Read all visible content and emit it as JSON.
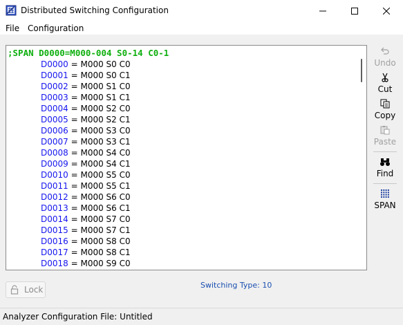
{
  "window": {
    "title": "Distributed Switching Configuration",
    "minimize_icon": "minimize-icon",
    "maximize_icon": "maximize-icon",
    "close_icon": "close-icon"
  },
  "menu": {
    "items": [
      {
        "label": "File"
      },
      {
        "label": "Configuration"
      }
    ]
  },
  "editor": {
    "header_line": ";SPAN D0000=M000-004 S0-14 C0-1",
    "header_color": "#0eaf0e",
    "device_color": "#1515ee",
    "rows": [
      {
        "device": "D0000",
        "mapping": " = M000 S0 C0"
      },
      {
        "device": "D0001",
        "mapping": " = M000 S0 C1"
      },
      {
        "device": "D0002",
        "mapping": " = M000 S1 C0"
      },
      {
        "device": "D0003",
        "mapping": " = M000 S1 C1"
      },
      {
        "device": "D0004",
        "mapping": " = M000 S2 C0"
      },
      {
        "device": "D0005",
        "mapping": " = M000 S2 C1"
      },
      {
        "device": "D0006",
        "mapping": " = M000 S3 C0"
      },
      {
        "device": "D0007",
        "mapping": " = M000 S3 C1"
      },
      {
        "device": "D0008",
        "mapping": " = M000 S4 C0"
      },
      {
        "device": "D0009",
        "mapping": " = M000 S4 C1"
      },
      {
        "device": "D0010",
        "mapping": " = M000 S5 C0"
      },
      {
        "device": "D0011",
        "mapping": " = M000 S5 C1"
      },
      {
        "device": "D0012",
        "mapping": " = M000 S6 C0"
      },
      {
        "device": "D0013",
        "mapping": " = M000 S6 C1"
      },
      {
        "device": "D0014",
        "mapping": " = M000 S7 C0"
      },
      {
        "device": "D0015",
        "mapping": " = M000 S7 C1"
      },
      {
        "device": "D0016",
        "mapping": " = M000 S8 C0"
      },
      {
        "device": "D0017",
        "mapping": " = M000 S8 C1"
      },
      {
        "device": "D0018",
        "mapping": " = M000 S9 C0"
      }
    ]
  },
  "toolbar": {
    "undo": {
      "label": "Undo",
      "icon": "undo-icon",
      "enabled": false
    },
    "cut": {
      "label": "Cut",
      "icon": "scissors-icon",
      "enabled": true
    },
    "copy": {
      "label": "Copy",
      "icon": "copy-icon",
      "enabled": true
    },
    "paste": {
      "label": "Paste",
      "icon": "paste-icon",
      "enabled": false
    },
    "find": {
      "label": "Find",
      "icon": "binoculars-icon",
      "enabled": true
    },
    "span": {
      "label": "SPAN",
      "icon": "grid-icon",
      "enabled": true
    }
  },
  "lock": {
    "label": "Lock",
    "icon": "lock-icon",
    "enabled": false
  },
  "switching_type": {
    "label": "Switching Type:",
    "value": "10"
  },
  "status": {
    "text": "Analyzer Configuration File: Untitled"
  }
}
